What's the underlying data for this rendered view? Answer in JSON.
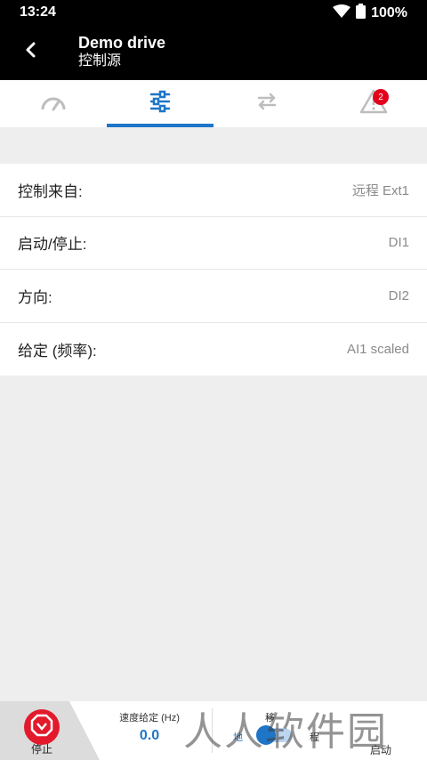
{
  "status": {
    "time": "13:24",
    "battery": "100%"
  },
  "app_bar": {
    "title": "Demo drive",
    "subtitle": "控制源"
  },
  "tabs": [
    {
      "name": "gauge-icon",
      "active": false
    },
    {
      "name": "sliders-icon",
      "active": true
    },
    {
      "name": "transfer-icon",
      "active": false
    },
    {
      "name": "warning-icon",
      "active": false,
      "badge": "2"
    }
  ],
  "list": [
    {
      "label": "控制来自:",
      "value": "远程 Ext1"
    },
    {
      "label": "启动/停止:",
      "value": "DI1"
    },
    {
      "label": "方向:",
      "value": "DI2"
    },
    {
      "label": "给定 (频率):",
      "value": "AI1 scaled"
    }
  ],
  "bottom": {
    "stop_label": "停止",
    "speed_label": "速度给定 (Hz)",
    "speed_value": "0.0",
    "control_label": "移",
    "local_label": "地",
    "remote_label": "程",
    "start_label": "启动"
  },
  "watermark": "人人软件园",
  "colors": {
    "accent": "#1f75c7",
    "stop": "#e21a2c",
    "badge": "#e3001b"
  }
}
